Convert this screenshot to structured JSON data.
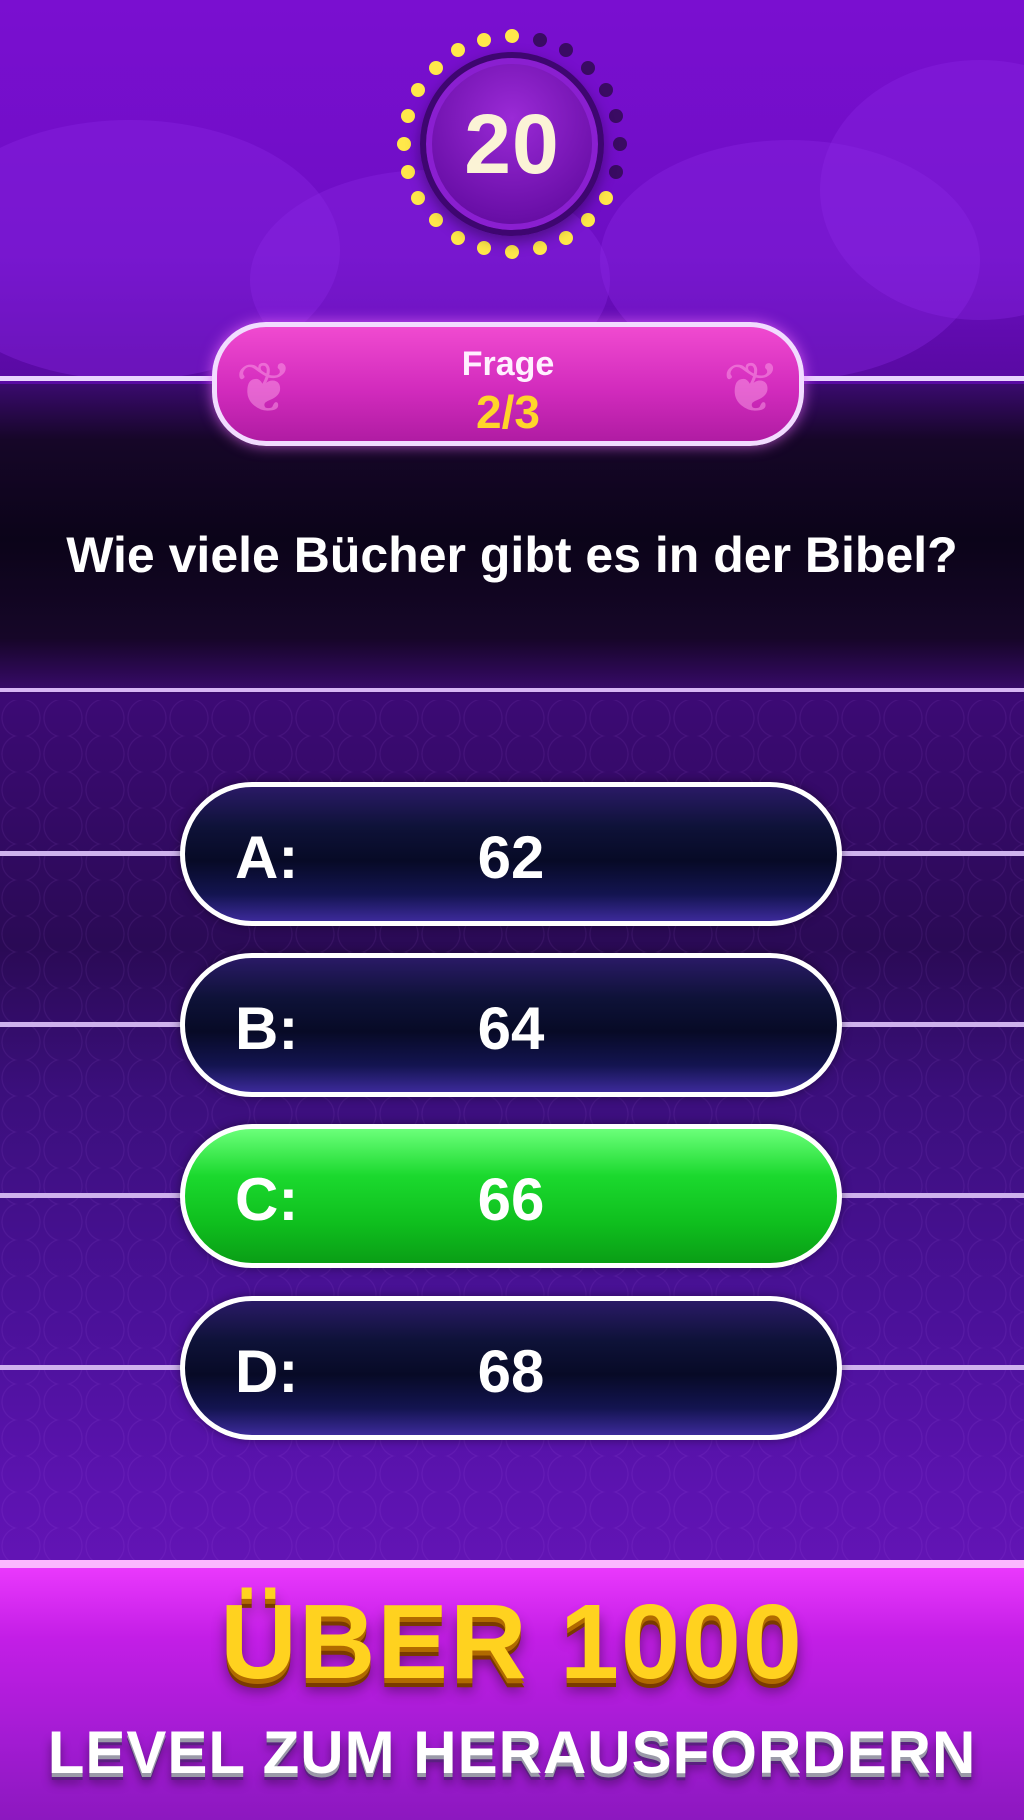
{
  "timer": {
    "value": "20",
    "dots_total": 24,
    "dots_active": 17,
    "active_color": "#ffe84a",
    "inactive_color": "#3a0b63"
  },
  "question_header": {
    "label": "Frage",
    "progress": "2/3"
  },
  "question": {
    "text": "Wie viele Bücher gibt es in der Bibel?"
  },
  "answers": [
    {
      "letter": "A:",
      "value": "62",
      "state": "default"
    },
    {
      "letter": "B:",
      "value": "64",
      "state": "default"
    },
    {
      "letter": "C:",
      "value": "66",
      "state": "correct"
    },
    {
      "letter": "D:",
      "value": "68",
      "state": "default"
    }
  ],
  "promo": {
    "title": "ÜBER 1000",
    "subtitle": "LEVEL ZUM HERAUSFORDERN"
  },
  "colors": {
    "correct": "#18d32a",
    "accent_pink": "#e03ccc",
    "gold": "#ffd21f"
  }
}
